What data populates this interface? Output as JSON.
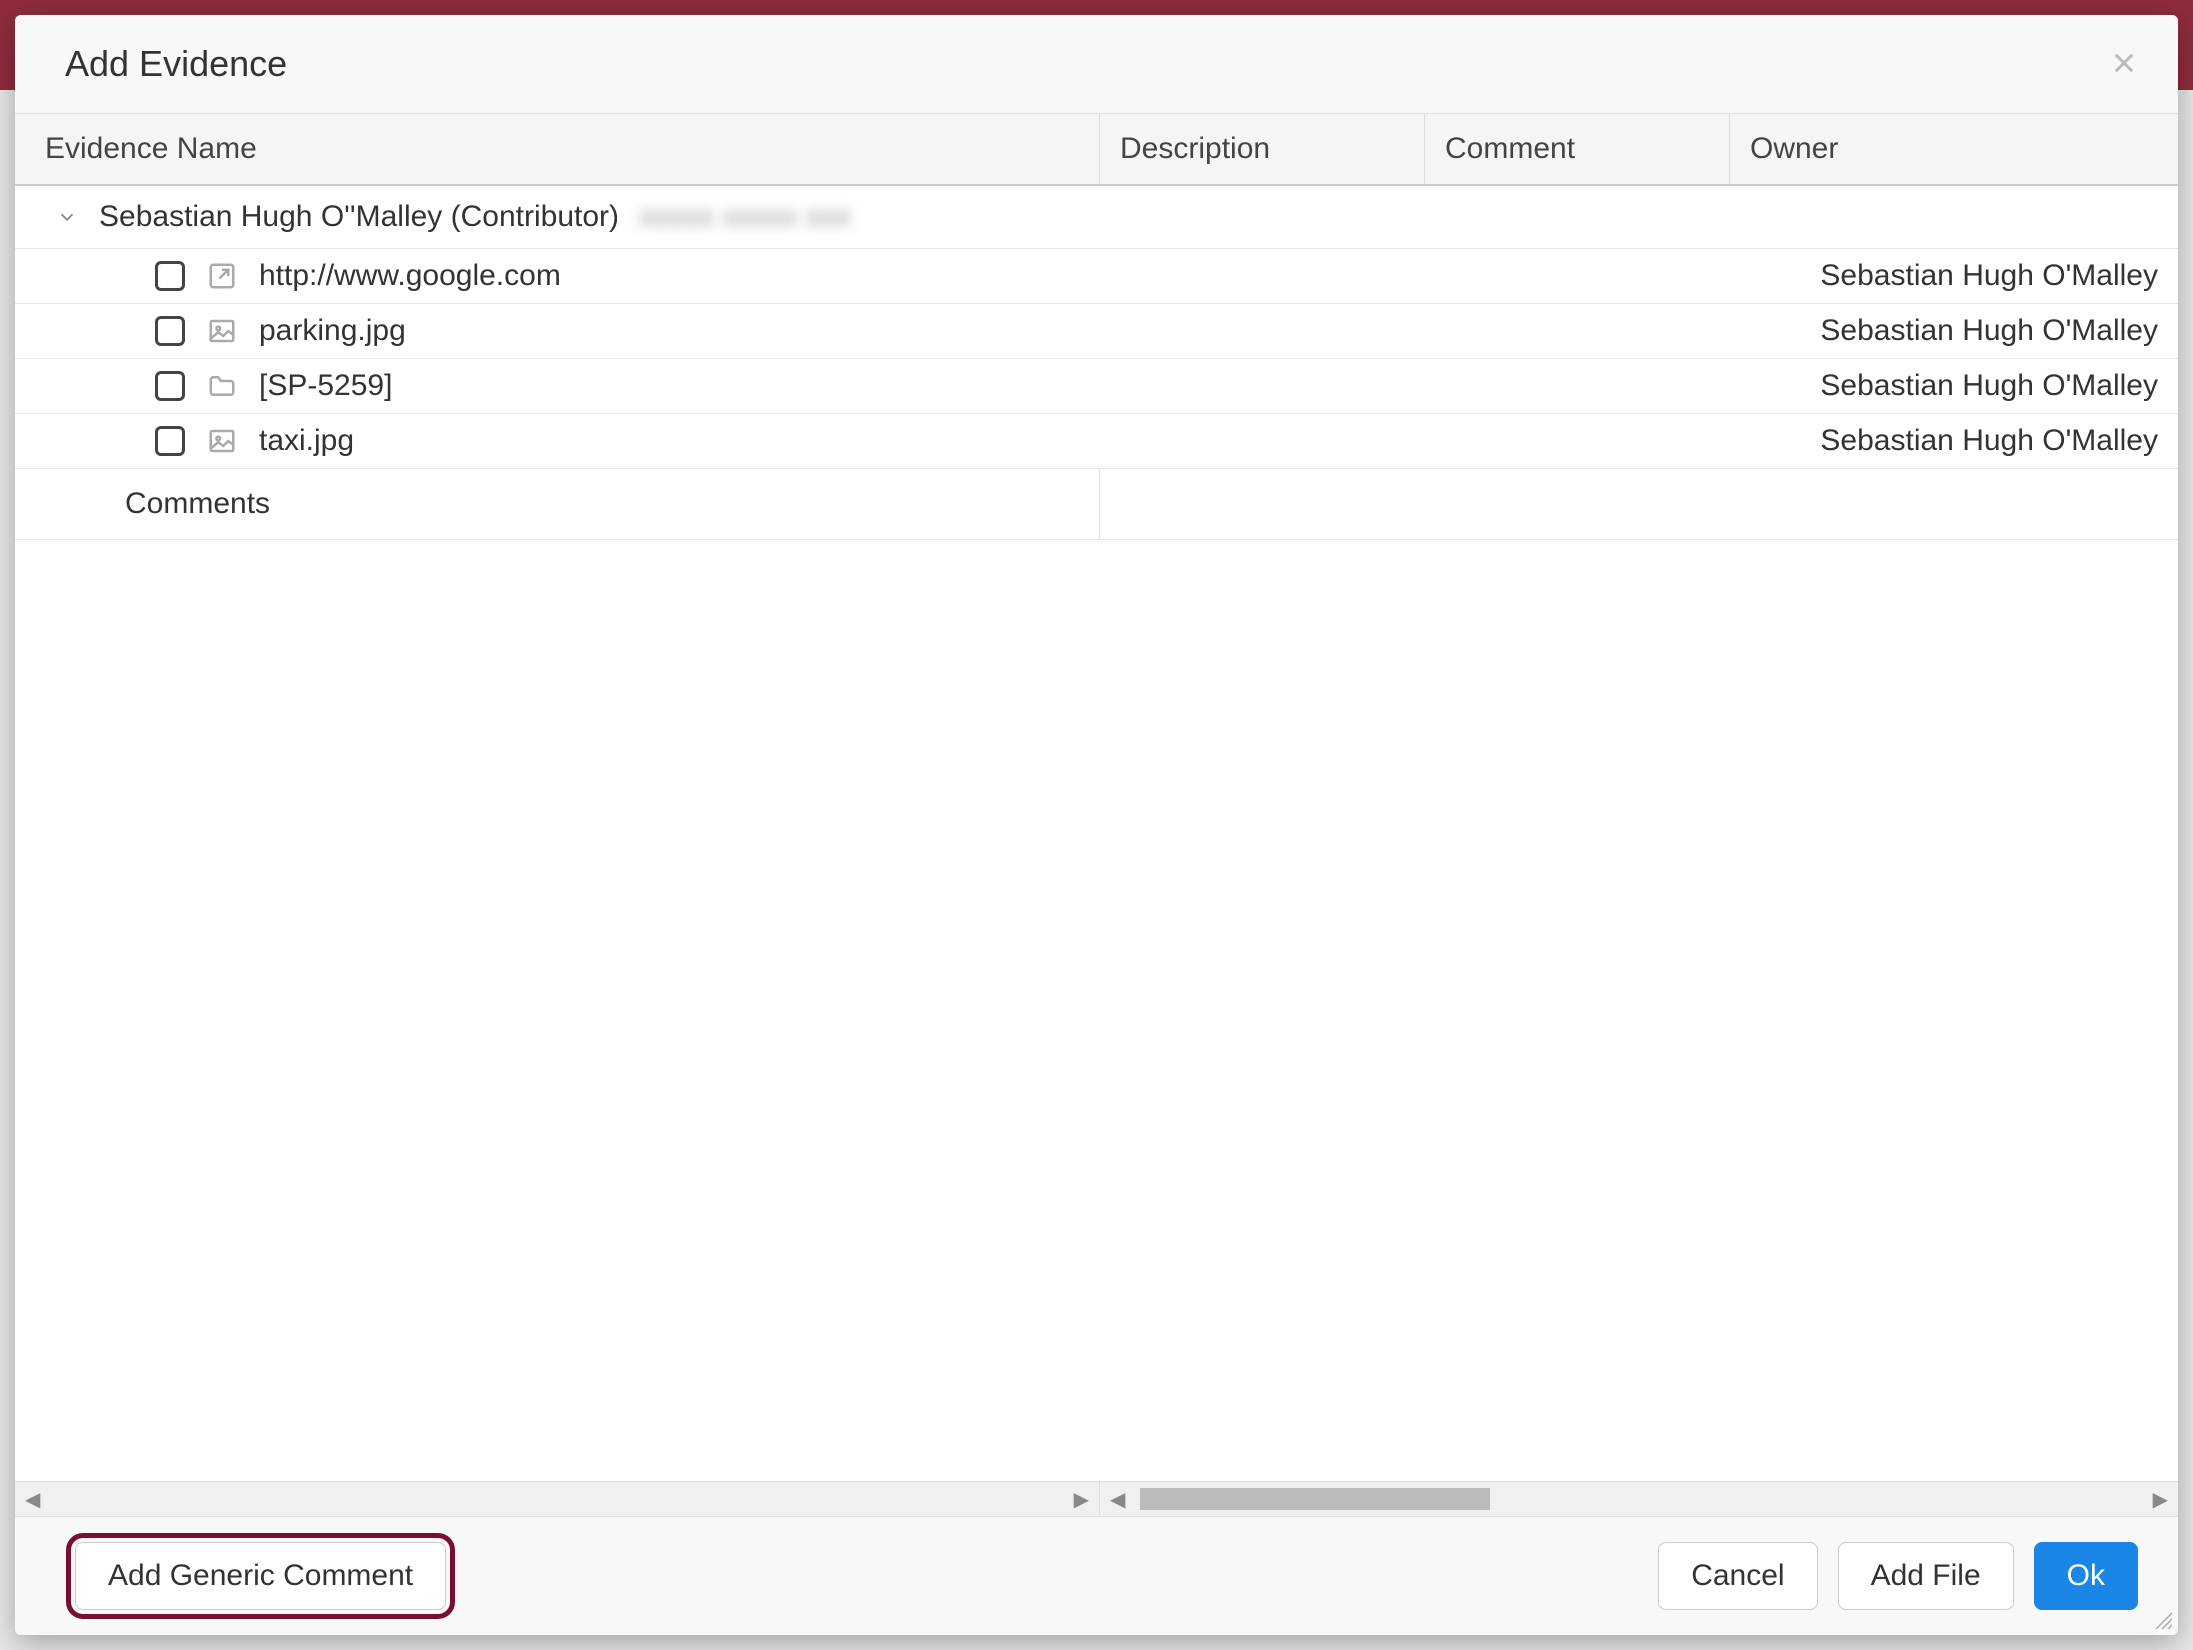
{
  "modal": {
    "title": "Add Evidence"
  },
  "columns": {
    "name": "Evidence Name",
    "description": "Description",
    "comment": "Comment",
    "owner": "Owner"
  },
  "group": {
    "label": "Sebastian Hugh O''Malley (Contributor)",
    "redacted": "redacted-text"
  },
  "rows": [
    {
      "name": "http://www.google.com",
      "icon": "link",
      "owner": "Sebastian Hugh O'Malley"
    },
    {
      "name": "parking.jpg",
      "icon": "image",
      "owner": "Sebastian Hugh O'Malley"
    },
    {
      "name": "[SP-5259]",
      "icon": "folder",
      "owner": "Sebastian Hugh O'Malley"
    },
    {
      "name": "taxi.jpg",
      "icon": "image",
      "owner": "Sebastian Hugh O'Malley"
    }
  ],
  "commentsRow": {
    "label": "Comments"
  },
  "footer": {
    "addGenericComment": "Add Generic Comment",
    "cancel": "Cancel",
    "addFile": "Add File",
    "ok": "Ok"
  }
}
